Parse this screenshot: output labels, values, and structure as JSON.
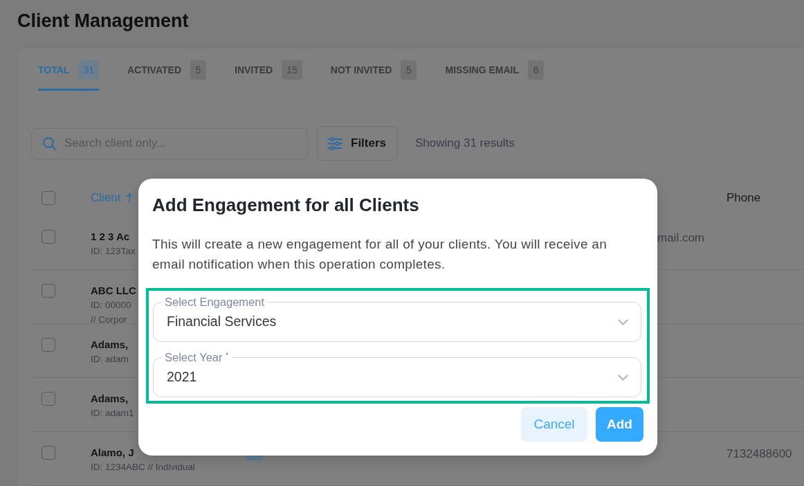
{
  "page_title": "Client Management",
  "tabs": [
    {
      "label": "TOTAL",
      "count": "31",
      "selected": true
    },
    {
      "label": "ACTIVATED",
      "count": "5",
      "selected": false
    },
    {
      "label": "INVITED",
      "count": "15",
      "selected": false
    },
    {
      "label": "NOT INVITED",
      "count": "5",
      "selected": false
    },
    {
      "label": "MISSING EMAIL",
      "count": "6",
      "selected": false
    }
  ],
  "search": {
    "placeholder": "Search client only..."
  },
  "filters_button": {
    "label": "Filters"
  },
  "results_summary": "Showing 31 results",
  "table": {
    "select_all_checked": false,
    "columns": [
      {
        "kind": "client",
        "label": "Client",
        "sorted": true
      },
      {
        "kind": "phone",
        "label": "Phone",
        "sorted": false
      }
    ],
    "rows": [
      {
        "checked": false,
        "name": "1 2 3 Ac",
        "details": [
          "ID: 123Tax"
        ],
        "email": "mail.com"
      },
      {
        "checked": false,
        "name": "ABC LLC",
        "details": [
          "ID: 00000",
          "// Corpor"
        ]
      },
      {
        "checked": false,
        "name": "Adams,",
        "details": [
          "ID: adam"
        ]
      },
      {
        "checked": false,
        "name": "Adams,",
        "details": [
          "ID: adam1"
        ]
      },
      {
        "checked": false,
        "name": "Alamo, J",
        "details": [
          "ID: 1234ABC // Individual"
        ],
        "phone": "7132488600",
        "tagged": true
      }
    ]
  },
  "dialog": {
    "title": "Add Engagement for all Clients",
    "message": "This will create a new engagement for all of your clients. You will receive an email notification when this operation completes.",
    "highlighted": true,
    "fields": [
      {
        "label": "Select Engagement",
        "value": "Financial Services"
      },
      {
        "label": "Select Year $^{*}$",
        "value": "2021"
      }
    ],
    "buttons": [
      {
        "label": "Cancel",
        "kind": "cancel"
      },
      {
        "label": "Add",
        "kind": "add"
      }
    ]
  }
}
